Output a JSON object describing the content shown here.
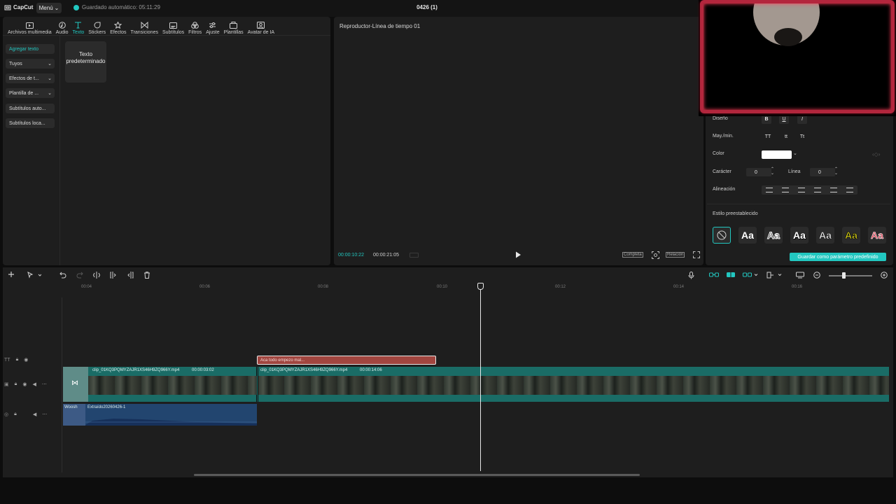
{
  "app": {
    "logo_text": "CapCut",
    "menu_label": "Menú",
    "autosave_text": "Guardado automático: 05:11:29",
    "project_title": "0426 (1)"
  },
  "toolbar": {
    "tabs": [
      {
        "label": "Archivos multimedia",
        "icon": "media-icon"
      },
      {
        "label": "Audio",
        "icon": "audio-icon"
      },
      {
        "label": "Texto",
        "icon": "text-icon",
        "active": true
      },
      {
        "label": "Stickers",
        "icon": "stickers-icon"
      },
      {
        "label": "Efectos",
        "icon": "effects-icon"
      },
      {
        "label": "Transiciones",
        "icon": "transitions-icon"
      },
      {
        "label": "Subtítulos",
        "icon": "subtitles-icon"
      },
      {
        "label": "Filtros",
        "icon": "filters-icon"
      },
      {
        "label": "Ajuste",
        "icon": "adjust-icon"
      },
      {
        "label": "Plantillas",
        "icon": "templates-icon"
      },
      {
        "label": "Avatar de IA",
        "icon": "ai-avatar-icon"
      }
    ]
  },
  "side_nav": {
    "items": [
      {
        "label": "Agregar texto",
        "active": true
      },
      {
        "label": "Tuyos",
        "has_chevron": true
      },
      {
        "label": "Efectos de t...",
        "has_chevron": true
      },
      {
        "label": "Plantilla de ...",
        "has_chevron": true
      },
      {
        "label": "Subtítulos auto..."
      },
      {
        "label": "Subtítulos loca..."
      }
    ],
    "default_text_card": "Texto predeterminado"
  },
  "player": {
    "title": "Reproductor-Línea de tiempo 01",
    "current_time": "00:00:10:22",
    "total_time": "00:00:21:05",
    "full_label": "Completa",
    "ratio_label": "Relación"
  },
  "properties": {
    "design_label": "Diseño",
    "design_buttons": [
      "B",
      "U",
      "I"
    ],
    "case_label": "May./min.",
    "case_buttons": [
      "TT",
      "tt",
      "Tt"
    ],
    "color_label": "Color",
    "color_value": "#ffffff",
    "char_label": "Carácter",
    "char_value": "0",
    "line_label": "Línea",
    "line_value": "0",
    "align_label": "Alineación",
    "preset_label": "Estilo preestablecido",
    "preset_sample": "Aa",
    "save_preset_label": "Guardar como parámetro predefinido"
  },
  "timeline": {
    "ruler_ticks": [
      "00:04",
      "00:06",
      "00:08",
      "00:10",
      "00:12",
      "00:14",
      "00:16"
    ],
    "text_clip_label": "Aca todo empezo mal...",
    "video_clip_a": {
      "name": "clip_01KQ3PQMYZAJR1XS46H9ZQ966Y.mp4",
      "duration": "00:00:03:02"
    },
    "video_clip_b": {
      "name": "clip_01KQ3PQMYZAJR1XS46H9ZQ966Y.mp4",
      "duration": "00:00:14:06"
    },
    "audio_clip_a": "Woosh",
    "audio_clip_b": "Extraído20260426-1"
  },
  "colors": {
    "accent": "#22c7c0",
    "text_clip": "#a1453f",
    "video_track": "#1a6c66",
    "audio_track": "#22456f"
  }
}
